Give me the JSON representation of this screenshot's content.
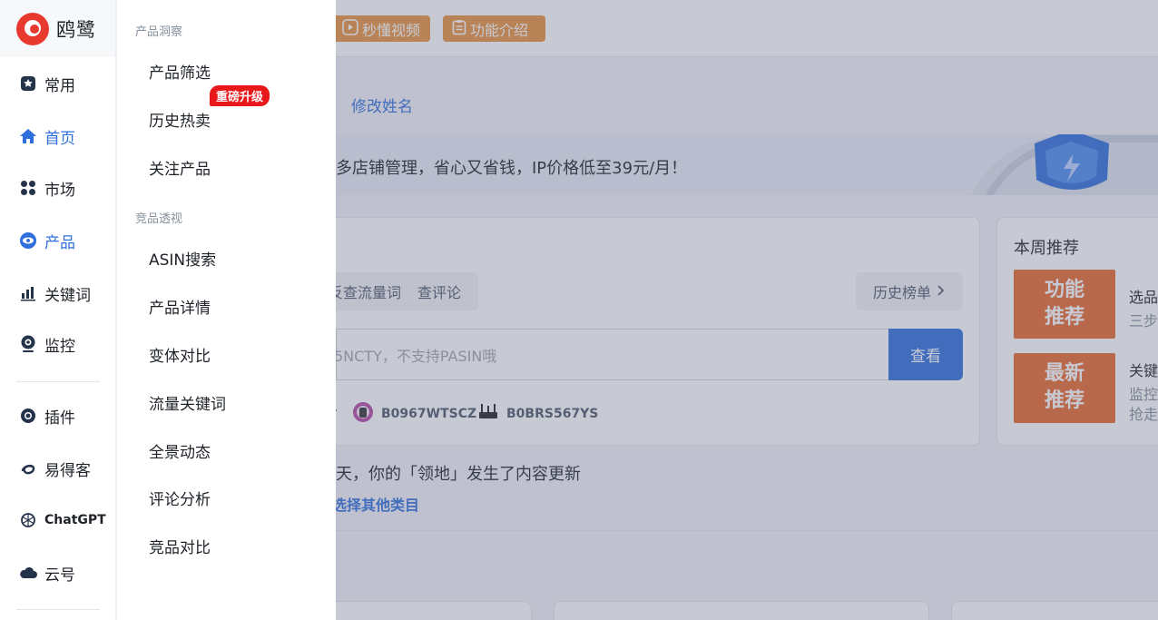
{
  "brand": {
    "name": "鸥鹭"
  },
  "sidebar": {
    "items": [
      {
        "label": "常用",
        "icon": "star-icon"
      },
      {
        "label": "首页",
        "icon": "home-icon"
      },
      {
        "label": "市场",
        "icon": "grid-icon"
      },
      {
        "label": "产品",
        "icon": "eye-icon"
      },
      {
        "label": "关键词",
        "icon": "bar-chart-icon"
      },
      {
        "label": "监控",
        "icon": "camera-icon"
      },
      {
        "label": "插件",
        "icon": "chrome-icon"
      },
      {
        "label": "易得客",
        "icon": "swirl-icon"
      },
      {
        "label": "ChatGPT",
        "icon": "openai-icon"
      },
      {
        "label": "云号",
        "icon": "cloud-icon"
      }
    ]
  },
  "flyout": {
    "group1": "产品洞察",
    "group1_items": [
      "产品筛选",
      "历史热卖",
      "关注产品"
    ],
    "badge": "重磅升级",
    "group2": "竞品透视",
    "group2_items": [
      "ASIN搜索",
      "产品详情",
      "变体对比",
      "流量关键词",
      "全景动态",
      "评论分析",
      "竞品对比"
    ]
  },
  "topbar": {
    "video_label": "秒懂视频",
    "intro_label": "功能介绍"
  },
  "main": {
    "rename": "修改姓名",
    "banner": "多店铺管理，省心又省钱，IP价格低至39元/月！",
    "tabs": [
      "反查流量词",
      "查评论"
    ],
    "history_label": "历史榜单",
    "search_placeholder": "5NCTY，不支持PASIN哦",
    "search_button": "查看",
    "asins": [
      "B0967WTSCZ",
      "B0BRS567YS"
    ],
    "update_text": "天，你的「领地」发生了内容更新",
    "category_link": "选择其他类目"
  },
  "weekly": {
    "title": "本周推荐",
    "promos": [
      {
        "line1": "功能",
        "line2": "推荐",
        "title": "选品",
        "sub": "三步"
      },
      {
        "line1": "最新",
        "line2": "推荐",
        "title": "关键",
        "sub": "监控",
        "sub2": "抢走"
      }
    ]
  },
  "colors": {
    "accent": "#2f6fdd",
    "brand": "#e8392f",
    "orange": "#e8923c",
    "badge": "#e8181a"
  }
}
